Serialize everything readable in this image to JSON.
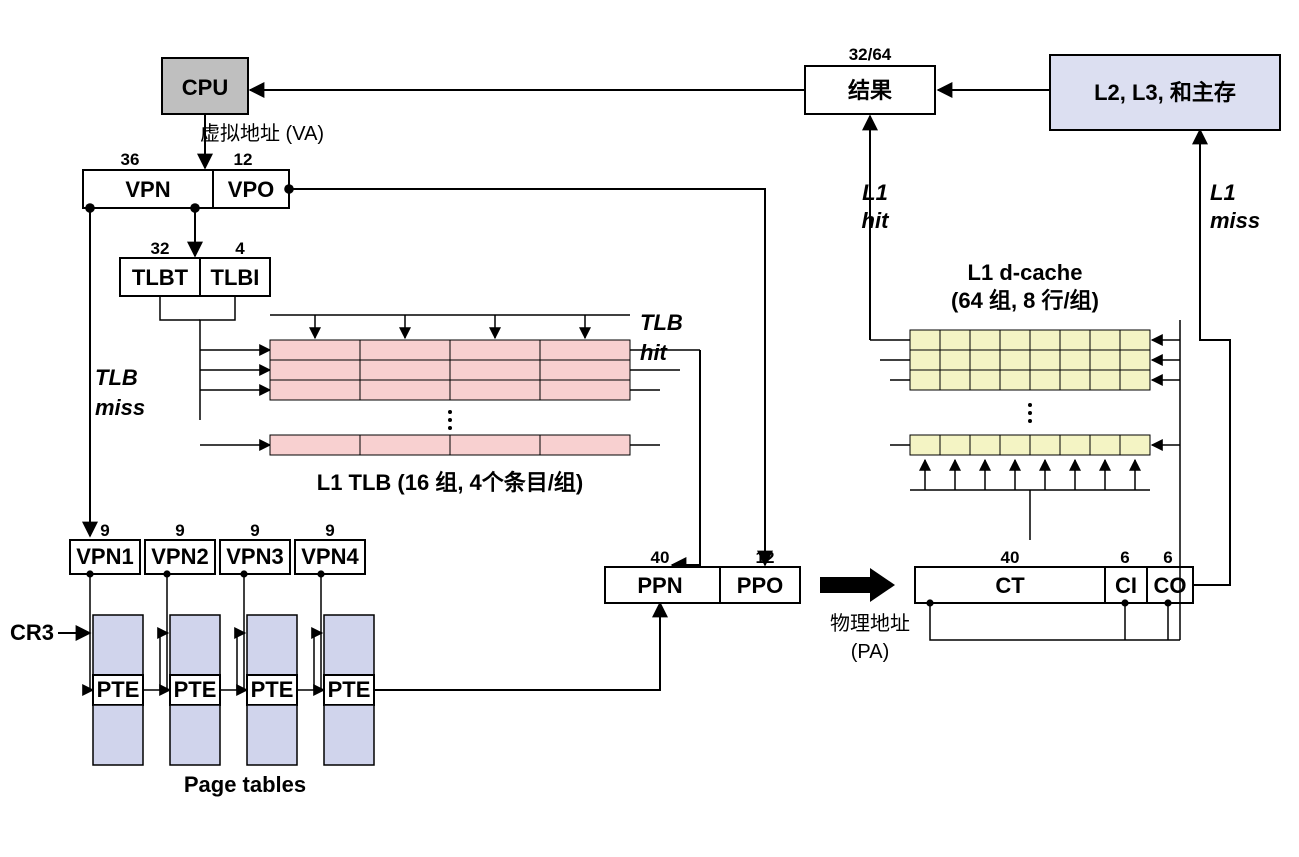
{
  "cpu": "CPU",
  "va_label": "虚拟地址 (VA)",
  "vpn": {
    "bits": "36",
    "name": "VPN"
  },
  "vpo": {
    "bits": "12",
    "name": "VPO"
  },
  "tlbt": {
    "bits": "32",
    "name": "TLBT"
  },
  "tlbi": {
    "bits": "4",
    "name": "TLBI"
  },
  "tlb_hit": "TLB hit",
  "tlb_miss": "TLB miss",
  "tlb_caption": "L1 TLB (16 组, 4个条目/组)",
  "vpn_parts": [
    {
      "bits": "9",
      "name": "VPN1"
    },
    {
      "bits": "9",
      "name": "VPN2"
    },
    {
      "bits": "9",
      "name": "VPN3"
    },
    {
      "bits": "9",
      "name": "VPN4"
    }
  ],
  "cr3": "CR3",
  "pte": "PTE",
  "page_tables": "Page tables",
  "ppn": {
    "bits": "40",
    "name": "PPN"
  },
  "ppo": {
    "bits": "12",
    "name": "PPO"
  },
  "pa_label1": "物理地址",
  "pa_label2": "(PA)",
  "result_bits": "32/64",
  "result": "结果",
  "mem": "L2, L3, 和主存",
  "l1_hit": "L1 hit",
  "l1_miss": "L1 miss",
  "l1d_title": "L1 d-cache",
  "l1d_sub": "(64 组, 8 行/组)",
  "ct": {
    "bits": "40",
    "name": "CT"
  },
  "ci": {
    "bits": "6",
    "name": "CI"
  },
  "co": {
    "bits": "6",
    "name": "CO"
  }
}
